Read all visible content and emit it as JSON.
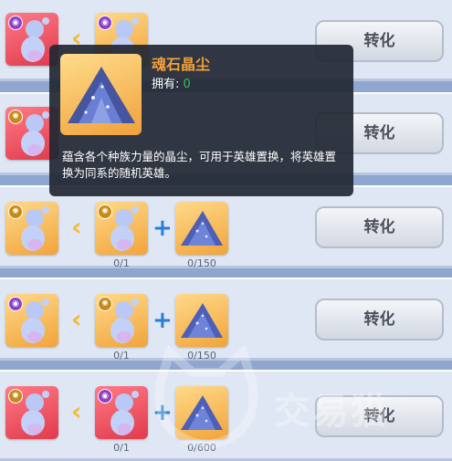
{
  "rows": [
    {
      "convert_label": "转化",
      "hero_count": "",
      "dust_count": ""
    },
    {
      "convert_label": "转化",
      "hero_count": "",
      "dust_count": ""
    },
    {
      "convert_label": "转化",
      "hero_count": "0/1",
      "dust_count": "0/150"
    },
    {
      "convert_label": "转化",
      "hero_count": "0/1",
      "dust_count": "0/150"
    },
    {
      "convert_label": "转化",
      "hero_count": "0/1",
      "dust_count": "0/600"
    }
  ],
  "tooltip": {
    "title": "魂石晶尘",
    "owned_label": "拥有:",
    "owned_value": "0",
    "description": "蕴含各个种族力量的晶尘，可用于英雄置换，将英雄置换为同系的随机英雄。"
  },
  "watermark": {
    "text": "交易猫"
  },
  "colors": {
    "tooltip_title": "#f2a13a",
    "owned_value": "#37c35a",
    "arrow": "#f6b92a",
    "plus": "#2a7ed8"
  }
}
